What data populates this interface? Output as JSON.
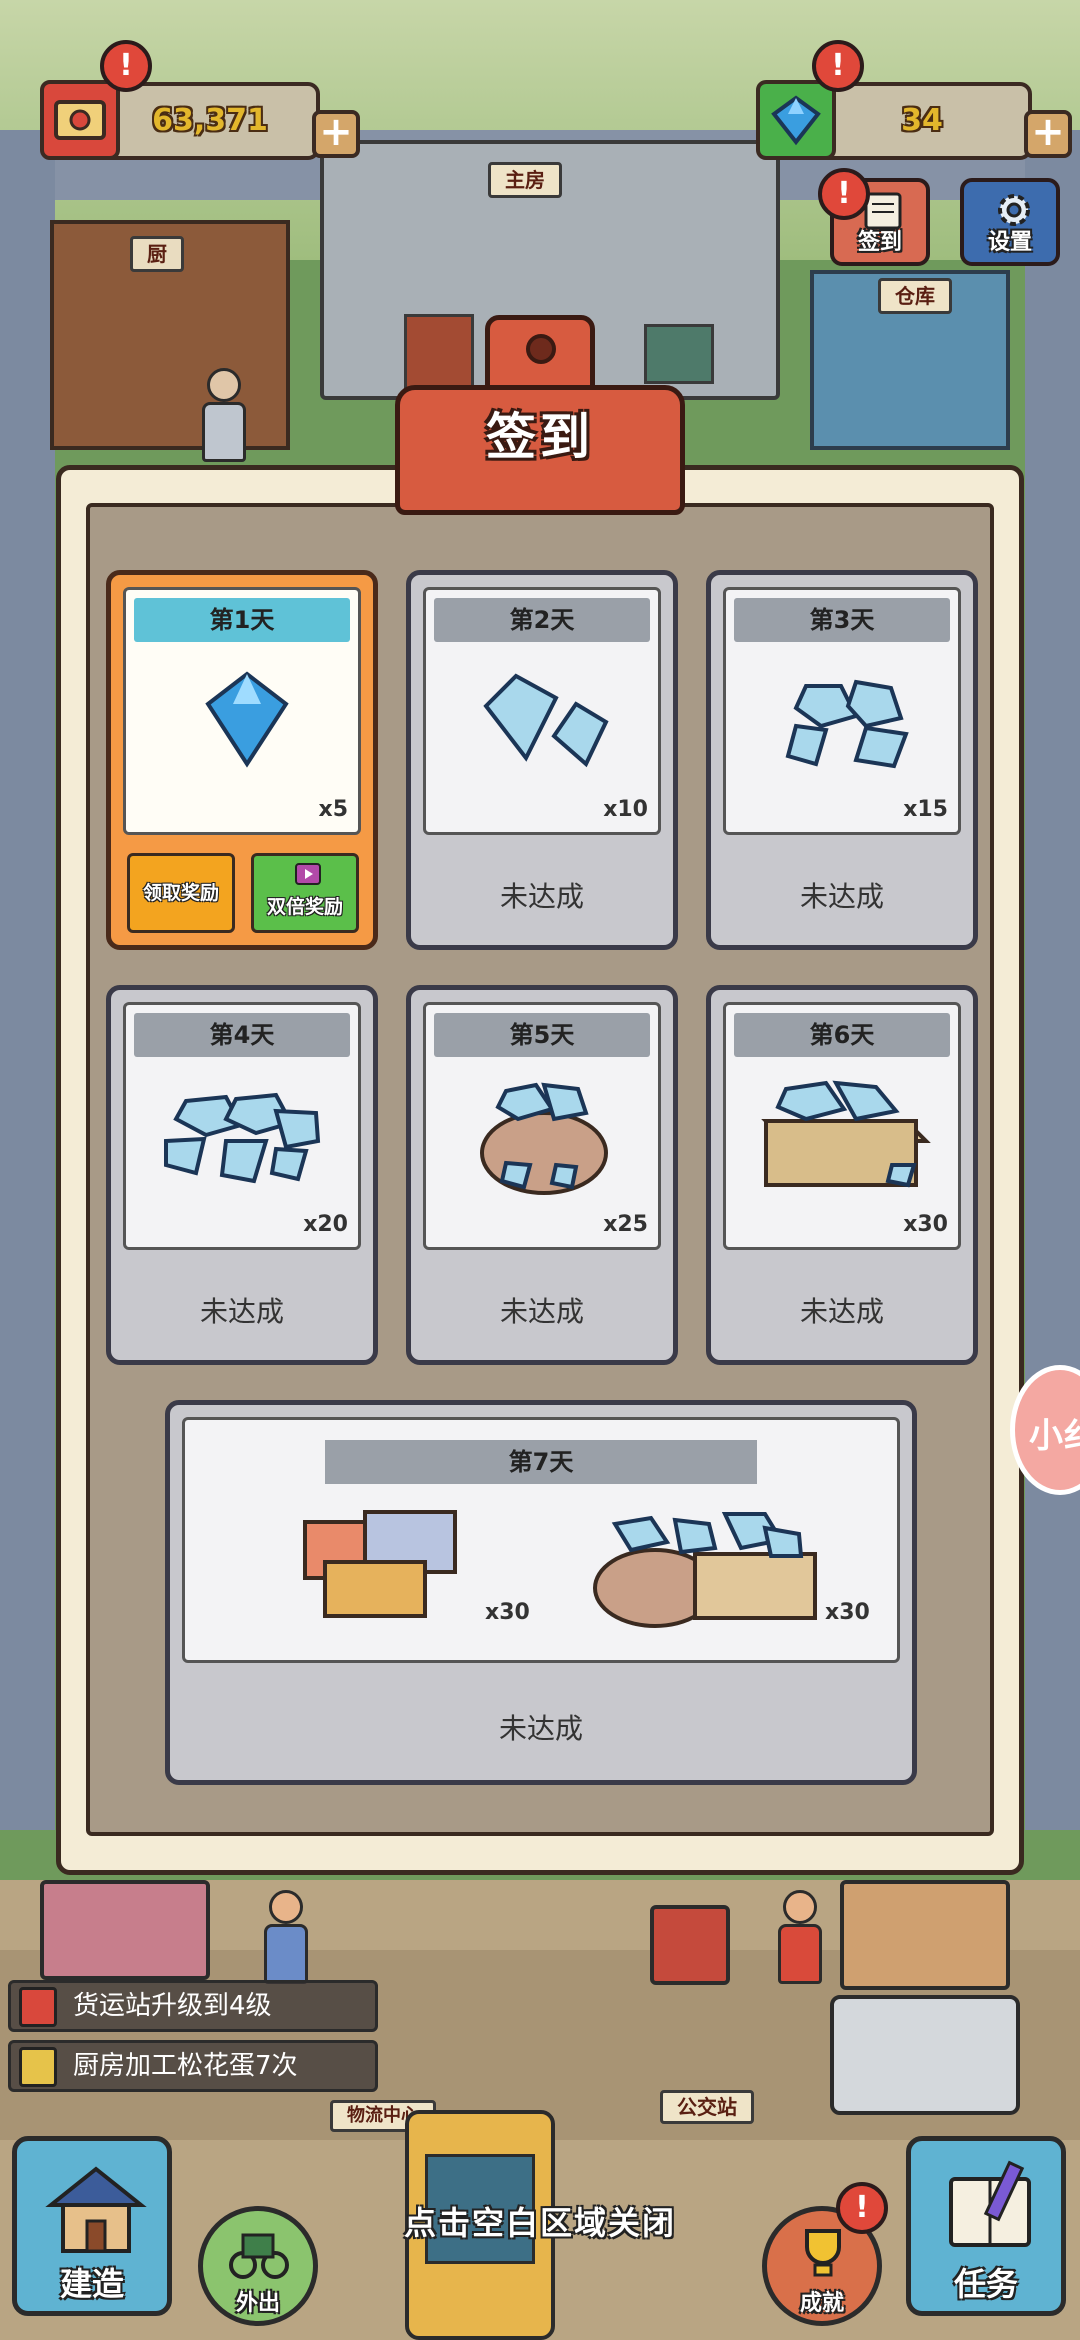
{
  "hud": {
    "coins": "63,371",
    "gems": "34",
    "alert_mark": "!",
    "plus": "+",
    "checkin_label": "签到",
    "settings_label": "设置"
  },
  "buildings": {
    "main_house": "主房",
    "kitchen": "厨",
    "warehouse": "仓库",
    "logistics": "物流中心",
    "bus_stop": "公交站"
  },
  "modal": {
    "title": "签到",
    "days": [
      {
        "label": "第1天",
        "reward_icon": "gem-single",
        "qty": "x5",
        "state": "claimable"
      },
      {
        "label": "第2天",
        "reward_icon": "gem-pair",
        "qty": "x10",
        "status": "未达成"
      },
      {
        "label": "第3天",
        "reward_icon": "gem-pile",
        "qty": "x15",
        "status": "未达成"
      },
      {
        "label": "第4天",
        "reward_icon": "gem-pile-large",
        "qty": "x20",
        "status": "未达成"
      },
      {
        "label": "第5天",
        "reward_icon": "gem-sack",
        "qty": "x25",
        "status": "未达成"
      },
      {
        "label": "第6天",
        "reward_icon": "gem-crate",
        "qty": "x30",
        "status": "未达成"
      }
    ],
    "day1_claim": "领取奖励",
    "day1_double": "双倍奖励",
    "day7": {
      "label": "第7天",
      "reward1_icon": "building-materials",
      "reward1_qty": "x30",
      "reward2_icon": "gem-sack-crate",
      "reward2_qty": "x30",
      "status": "未达成"
    }
  },
  "side_float": "小纟",
  "tasks": [
    {
      "text": "货运站升级到4级",
      "icon": "task-book-icon"
    },
    {
      "text": "厨房加工松花蛋7次",
      "icon": "task-recipe-icon"
    }
  ],
  "bottom": {
    "build": "建造",
    "outing": "外出",
    "achievement": "成就",
    "missions": "任务",
    "close_hint": "点击空白区域关闭"
  },
  "colors": {
    "modal_tab": "#d75b40",
    "active_card": "#f59a45",
    "day_header_active": "#5fc2d7",
    "claim_button": "#f3a41f",
    "double_button": "#5bbf4a",
    "gem": "#3a9ee0"
  }
}
